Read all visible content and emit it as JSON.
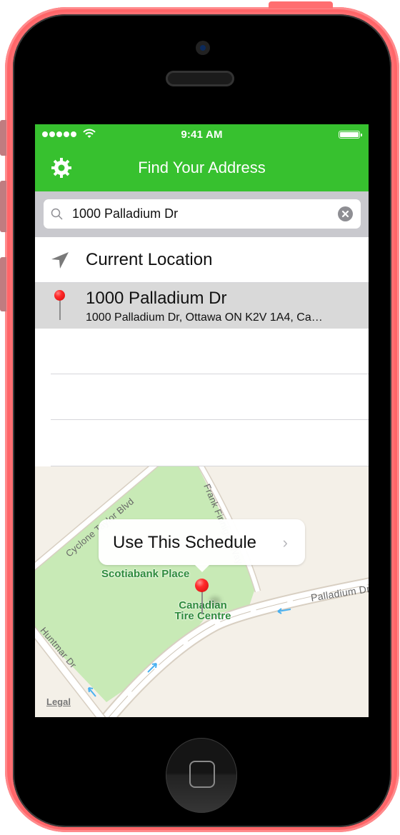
{
  "device": {
    "frame_color": "#ff6f72",
    "model": "iPhone 5c"
  },
  "status_bar": {
    "signal_bars": 5,
    "time": "9:41 AM",
    "battery_level": 1.0
  },
  "nav_bar": {
    "title": "Find Your Address",
    "settings_icon": "gear-icon",
    "background_color": "#37c12f"
  },
  "search": {
    "value": "1000 Palladium Dr",
    "placeholder": "",
    "search_icon": "search-icon",
    "clear_icon": "clear-icon"
  },
  "results": [
    {
      "type": "current-location",
      "icon": "location-arrow-icon",
      "title": "Current Location",
      "selected": false
    },
    {
      "type": "address",
      "icon": "pin-icon",
      "title": "1000 Palladium Dr",
      "subtitle": "1000 Palladium Dr, Ottawa ON K2V 1A4, Ca…",
      "selected": true
    }
  ],
  "map": {
    "callout": {
      "label": "Use This Schedule",
      "chevron": "›"
    },
    "streets": [
      "Cyclone Taylor Blvd",
      "Frank Finnigan Way",
      "Palladium Dr",
      "Huntmar Dr"
    ],
    "pois": [
      "Scotiabank Place",
      "Canadian",
      "Tire Centre"
    ],
    "legal_link": "Legal"
  }
}
